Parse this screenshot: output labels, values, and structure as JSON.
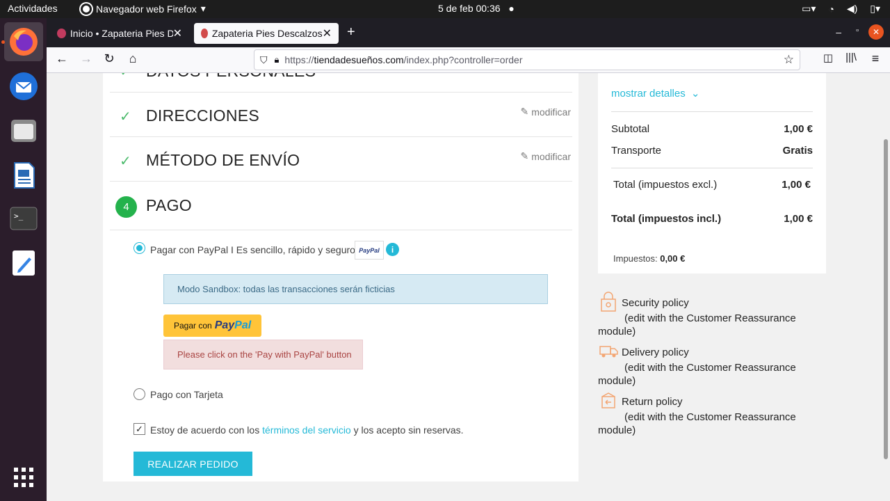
{
  "system": {
    "activities": "Actividades",
    "app_name": "Navegador web Firefox",
    "clock": "5 de feb  00:36"
  },
  "dock": {
    "items": [
      "firefox-icon",
      "thunderbird-icon",
      "files-icon",
      "writer-icon",
      "terminal-icon",
      "text-editor-icon",
      "apps-grid-icon"
    ]
  },
  "browser": {
    "tabs": [
      {
        "label": "Inicio • Zapateria Pies Des"
      },
      {
        "label": "Zapateria Pies Descalzos"
      }
    ],
    "url_scheme": "https://",
    "url_host": "tiendadesueños.com",
    "url_path": "/index.php?controller=order"
  },
  "checkout": {
    "partial_step": "DATOS PERSONALES",
    "steps": [
      {
        "title": "DIRECCIONES",
        "modify": "modificar"
      },
      {
        "title": "MÉTODO DE ENVÍO",
        "modify": "modificar"
      }
    ],
    "payment_step": {
      "number": "4",
      "title": "PAGO"
    },
    "paypal_option": "Pagar con PayPal I Es sencillo, rápido y seguro",
    "paypal_logo": "PayPal",
    "info_icon": "i",
    "sandbox_notice": "Modo Sandbox: todas las transacciones serán ficticias",
    "paypal_button_prefix": "Pagar con",
    "paypal_word_a": "Pay",
    "paypal_word_b": "Pal",
    "error_message": "Please click on the 'Pay with PayPal' button",
    "card_option": "Pago con Tarjeta",
    "terms_prefix": "Estoy de acuerdo con los ",
    "terms_link": "términos del servicio",
    "terms_suffix": " y los acepto sin reservas.",
    "terms_checked": true,
    "order_button": "REALIZAR PEDIDO"
  },
  "summary": {
    "show_details": "mostrar detalles",
    "subtotal_label": "Subtotal",
    "subtotal_value": "1,00 €",
    "shipping_label": "Transporte",
    "shipping_value": "Gratis",
    "total_excl_label": "Total (impuestos excl.)",
    "total_excl_value": "1,00 €",
    "total_incl_label": "Total (impuestos incl.)",
    "total_incl_value": "1,00 €",
    "taxes_label": "Impuestos:",
    "taxes_value": "0,00 €"
  },
  "reassurance": [
    {
      "title": "Security policy",
      "sub": "(edit with the Customer Reassurance",
      "sub2": "module)"
    },
    {
      "title": "Delivery policy",
      "sub": "(edit with the Customer Reassurance",
      "sub2": "module)"
    },
    {
      "title": "Return policy",
      "sub": "(edit with the Customer Reassurance",
      "sub2": "module)"
    }
  ],
  "colors": {
    "accent": "#24b9d7",
    "success": "#24b24c",
    "dock": "#2b1d2b"
  }
}
